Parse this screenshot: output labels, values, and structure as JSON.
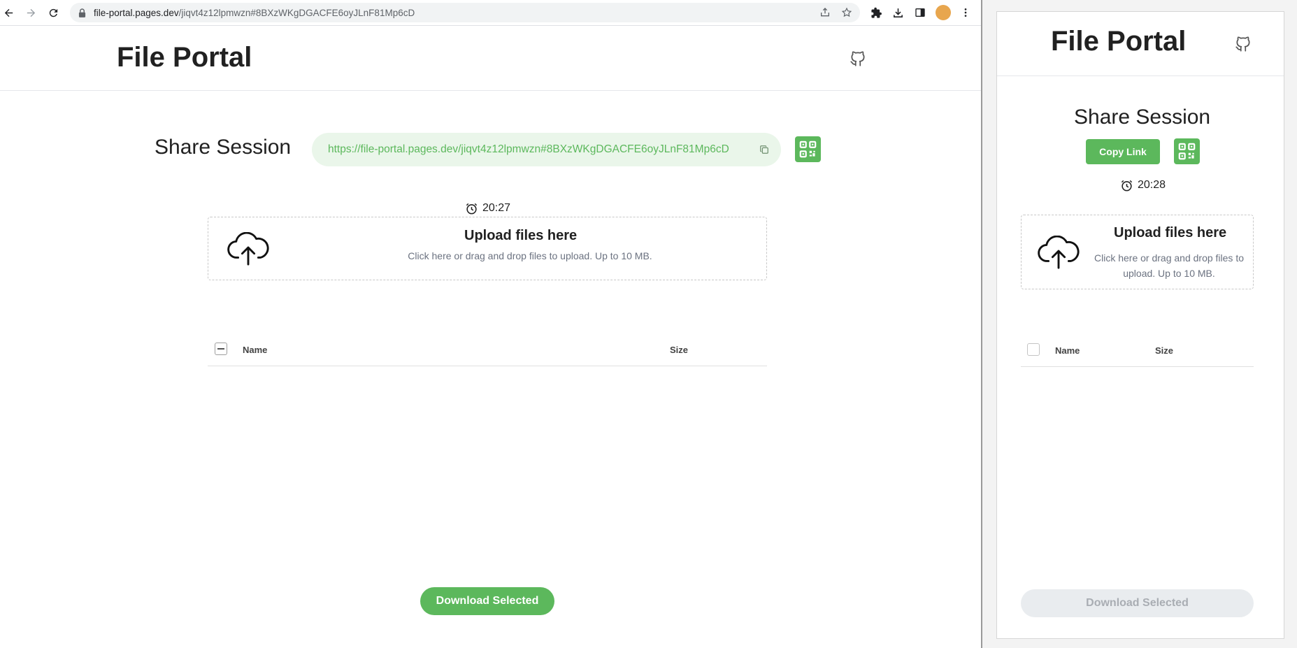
{
  "browser": {
    "url_host": "file-portal.pages.dev",
    "url_rest": "/jiqvt4z12lpmwzn#8BXzWKgDGACFE6oyJLnF81Mp6cD",
    "avatar_color": "#e8a64e"
  },
  "main": {
    "title": "File Portal",
    "share_label": "Share Session",
    "share_link": "https://file-portal.pages.dev/jiqvt4z12lpmwzn#8BXzWKgDGACFE6oyJLnF81Mp6cD",
    "timer": "20:27",
    "upload_title": "Upload files here",
    "upload_sub": "Click here or drag and drop files to upload. Up to 10 MB.",
    "col_name": "Name",
    "col_size": "Size",
    "download_label": "Download Selected"
  },
  "side": {
    "title": "File Portal",
    "share_label": "Share Session",
    "copy_link_label": "Copy Link",
    "timer": "20:28",
    "upload_title": "Upload files here",
    "upload_sub": "Click here or drag and drop files to upload. Up to 10 MB.",
    "col_name": "Name",
    "col_size": "Size",
    "download_label": "Download Selected"
  },
  "colors": {
    "accent": "#5cb85c",
    "accent_light": "#eaf6ea",
    "disabled_bg": "#e9ecef",
    "disabled_text": "#a9adb3"
  },
  "icons": [
    "back-arrow-icon",
    "forward-arrow-icon",
    "reload-icon",
    "lock-icon",
    "share-icon",
    "star-icon",
    "extensions-icon",
    "download-icon",
    "side-panel-icon",
    "menu-dots-icon",
    "github-icon",
    "copy-icon",
    "qr-code-icon",
    "alarm-clock-icon",
    "cloud-upload-icon"
  ]
}
